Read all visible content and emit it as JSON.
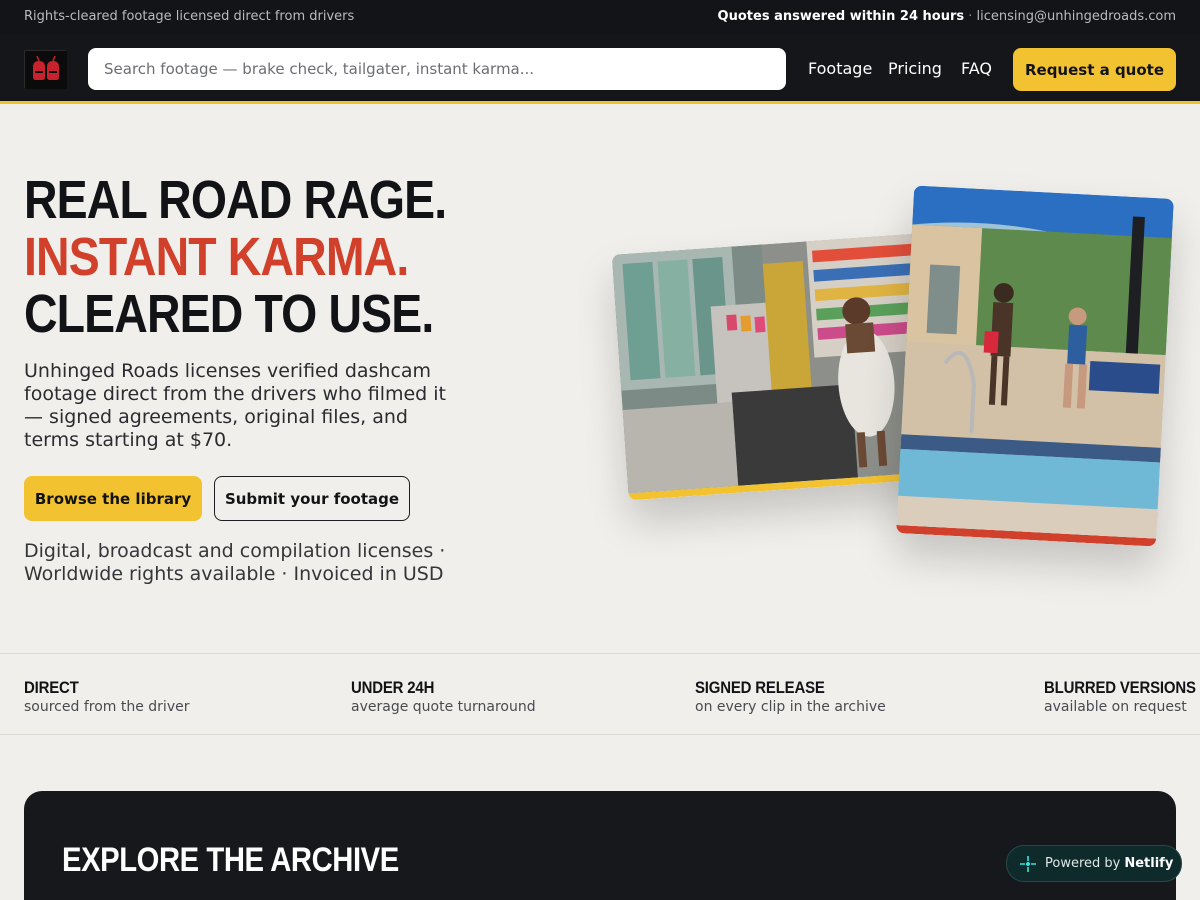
{
  "topbar": {
    "left_text": "Rights-cleared footage licensed direct from drivers",
    "quote_text": "Quotes answered within 24 hours",
    "separator": "·",
    "email": "licensing@unhingedroads.com"
  },
  "nav": {
    "search_placeholder": "Search footage — brake check, tailgater, instant karma...",
    "links": [
      "Footage",
      "Pricing",
      "FAQ"
    ],
    "cta": "Request a quote"
  },
  "hero": {
    "headline_1": "REAL ROAD RAGE.",
    "headline_2": "INSTANT KARMA.",
    "headline_3": "CLEARED TO USE.",
    "lead": "Unhinged Roads licenses verified dashcam footage direct from the drivers who filmed it — signed agreements, original files, and terms starting at $70.",
    "primary_button": "Browse the library",
    "secondary_button": "Submit your footage",
    "fine_print": "Digital, broadcast and compilation licenses · Worldwide rights available · Invoiced in USD"
  },
  "stats": [
    {
      "title": "DIRECT",
      "desc": "sourced from the driver"
    },
    {
      "title": "UNDER 24H",
      "desc": "average quote turnaround"
    },
    {
      "title": "SIGNED RELEASE",
      "desc": "on every clip in the archive"
    },
    {
      "title": "BLURRED VERSIONS",
      "desc": "available on request"
    }
  ],
  "archive": {
    "title": "EXPLORE THE ARCHIVE"
  },
  "badge": {
    "prefix": "Powered by",
    "brand": "Netlify"
  },
  "colors": {
    "accent": "#f2c230",
    "red": "#d0402a",
    "dark": "#15161a",
    "background": "#f1efeb"
  }
}
